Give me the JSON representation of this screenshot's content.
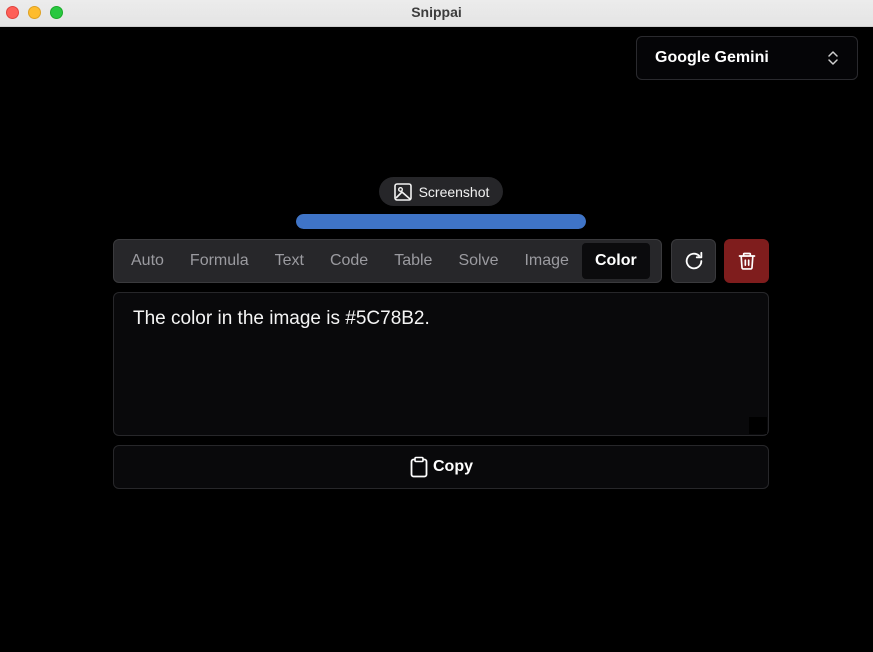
{
  "window": {
    "title": "Snippai"
  },
  "model": {
    "selected": "Google Gemini",
    "icon": "chevron-up-down-icon"
  },
  "source": {
    "label": "Screenshot",
    "icon": "image-icon"
  },
  "progress": {
    "value": 1.0,
    "color": "#3f74c7"
  },
  "modes": {
    "items": [
      "Auto",
      "Formula",
      "Text",
      "Code",
      "Table",
      "Solve",
      "Image",
      "Color"
    ],
    "active": "Color"
  },
  "actions": {
    "refresh_icon": "refresh-icon",
    "delete_icon": "trash-icon",
    "delete_color": "#7f1d1d"
  },
  "output": {
    "text": "The color in the image is #5C78B2."
  },
  "copy": {
    "label": "Copy",
    "icon": "clipboard-icon"
  }
}
